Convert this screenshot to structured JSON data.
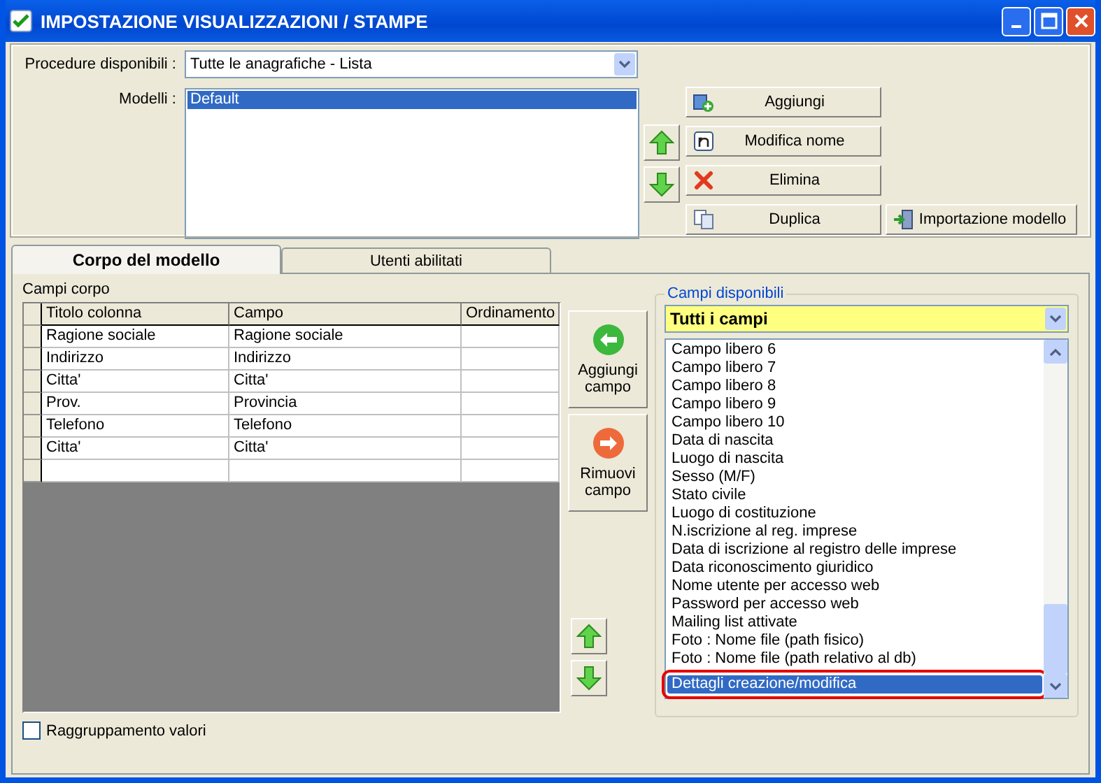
{
  "window": {
    "title": "IMPOSTAZIONE VISUALIZZAZIONI / STAMPE"
  },
  "procedure": {
    "label": "Procedure disponibili :",
    "value": "Tutte le anagrafiche - Lista"
  },
  "models": {
    "label": "Modelli :",
    "items": [
      {
        "text": "Default",
        "selected": true
      }
    ]
  },
  "model_buttons": [
    {
      "label": "Aggiungi",
      "kind": "add"
    },
    {
      "label": "Modifica nome",
      "kind": "rename"
    },
    {
      "label": "Elimina",
      "kind": "delete"
    },
    {
      "label": "Duplica",
      "kind": "duplicate"
    },
    {
      "label": "Importazione modello",
      "kind": "import"
    }
  ],
  "tabs": [
    {
      "label": "Corpo del modello",
      "selected": true
    },
    {
      "label": "Utenti abilitati",
      "selected": false
    }
  ],
  "body_fields": {
    "title": "Campi corpo",
    "columns": [
      "Titolo colonna",
      "Campo",
      "Ordinamento"
    ],
    "rows": [
      [
        "Ragione sociale",
        "Ragione sociale",
        ""
      ],
      [
        "Indirizzo",
        "Indirizzo",
        ""
      ],
      [
        "Citta'",
        "Citta'",
        ""
      ],
      [
        "Prov.",
        "Provincia",
        ""
      ],
      [
        "Telefono",
        "Telefono",
        ""
      ],
      [
        "Citta'",
        "Citta'",
        ""
      ]
    ]
  },
  "field_buttons": [
    {
      "label": "Aggiungi campo",
      "kind": "add"
    },
    {
      "label": "Rimuovi campo",
      "kind": "remove"
    }
  ],
  "available_fields": {
    "title": "Campi disponibili",
    "filter": "Tutti i campi",
    "highlighted": true,
    "items": [
      {
        "text": "Campo libero 6",
        "selected": false
      },
      {
        "text": "Campo libero 7",
        "selected": false
      },
      {
        "text": "Campo libero 8",
        "selected": false
      },
      {
        "text": "Campo libero 9",
        "selected": false
      },
      {
        "text": "Campo libero 10",
        "selected": false
      },
      {
        "text": "Data di nascita",
        "selected": false
      },
      {
        "text": "Luogo di nascita",
        "selected": false
      },
      {
        "text": "Sesso (M/F)",
        "selected": false
      },
      {
        "text": "Stato civile",
        "selected": false
      },
      {
        "text": "Luogo di costituzione",
        "selected": false
      },
      {
        "text": "N.iscrizione al reg. imprese",
        "selected": false
      },
      {
        "text": "Data di iscrizione al registro delle imprese",
        "selected": false
      },
      {
        "text": "Data riconoscimento giuridico",
        "selected": false
      },
      {
        "text": "Nome utente per accesso web",
        "selected": false
      },
      {
        "text": "Password per accesso web",
        "selected": false
      },
      {
        "text": "Mailing list attivate",
        "selected": false
      },
      {
        "text": "Foto : Nome file (path fisico)",
        "selected": false
      },
      {
        "text": "Foto : Nome file (path relativo al db)",
        "selected": false
      },
      {
        "text": "Dettagli creazione/modifica",
        "selected": true
      }
    ]
  },
  "grouping": {
    "label": "Raggruppamento valori",
    "checked": false
  }
}
